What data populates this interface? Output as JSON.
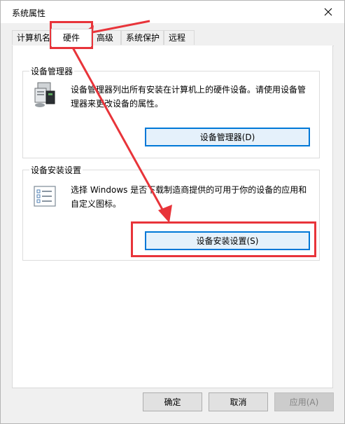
{
  "window": {
    "title": "系统属性"
  },
  "tabs": [
    {
      "label": "计算机名"
    },
    {
      "label": "硬件"
    },
    {
      "label": "高级"
    },
    {
      "label": "系统保护"
    },
    {
      "label": "远程"
    }
  ],
  "device_manager": {
    "group_title": "设备管理器",
    "description": "设备管理器列出所有安装在计算机上的硬件设备。请使用设备管理器来更改设备的属性。",
    "button_label": "设备管理器(D)"
  },
  "device_install": {
    "group_title": "设备安装设置",
    "description": "选择 Windows 是否下载制造商提供的可用于你的设备的应用和自定义图标。",
    "button_label": "设备安装设置(S)"
  },
  "footer": {
    "ok_label": "确定",
    "cancel_label": "取消",
    "apply_label": "应用(A)"
  },
  "colors": {
    "annotation_red": "#e8343a",
    "focus_blue": "#0078d7"
  }
}
